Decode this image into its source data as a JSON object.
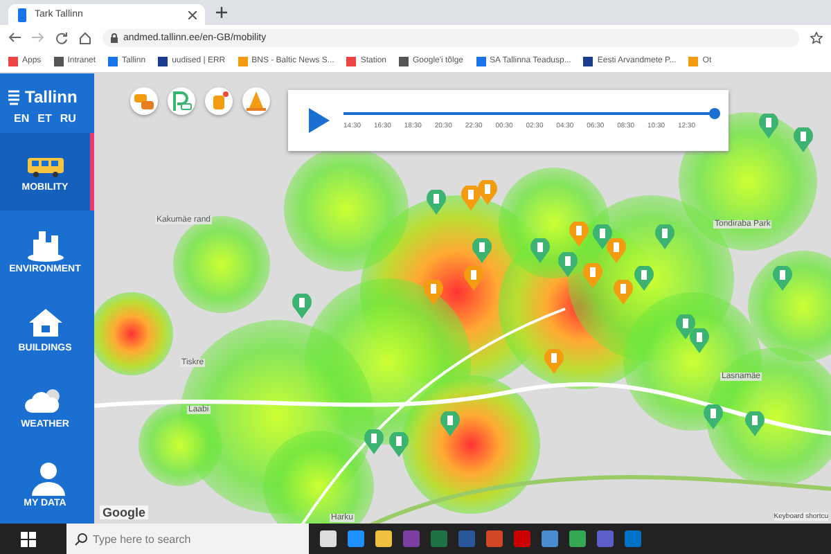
{
  "browser": {
    "tab_title": "Tark Tallinn",
    "url": "andmed.tallinn.ee/en-GB/mobility",
    "bookmarks": [
      "Apps",
      "Intranet",
      "Tallinn",
      "uudised | ERR",
      "BNS - Baltic News S...",
      "Station",
      "Google'i tõlge",
      "SA Tallinna Teadusp...",
      "Eesti Arvandmete P...",
      "Ot"
    ]
  },
  "sidebar": {
    "logo": "Tallinn",
    "languages": [
      "EN",
      "ET",
      "RU"
    ],
    "items": [
      {
        "label": "MOBILITY",
        "kind": "bus",
        "selected": true
      },
      {
        "label": "ENVIRONMENT",
        "kind": "city",
        "selected": false
      },
      {
        "label": "BUILDINGS",
        "kind": "house",
        "selected": false
      },
      {
        "label": "WEATHER",
        "kind": "weather",
        "selected": false
      },
      {
        "label": "MY DATA",
        "kind": "user",
        "selected": false
      }
    ]
  },
  "layers": [
    {
      "kind": "traffic"
    },
    {
      "kind": "parking"
    },
    {
      "kind": "accident"
    },
    {
      "kind": "roadwork"
    }
  ],
  "timeline": {
    "level": 1,
    "times": [
      "14:30",
      "16:30",
      "18:30",
      "20:30",
      "22:30",
      "00:30",
      "02:30",
      "04:30",
      "06:30",
      "08:30",
      "10:30",
      "12:30"
    ]
  },
  "map": {
    "labels": [
      "Kakumäe rand",
      "Tiskre",
      "Laabi",
      "Harku",
      "Tondiraba Park",
      "Lasnamäe"
    ],
    "attribution": "Google",
    "shortcuts": "Keyboard shortcu"
  },
  "taskbar": {
    "search_placeholder": "Type here to search"
  }
}
